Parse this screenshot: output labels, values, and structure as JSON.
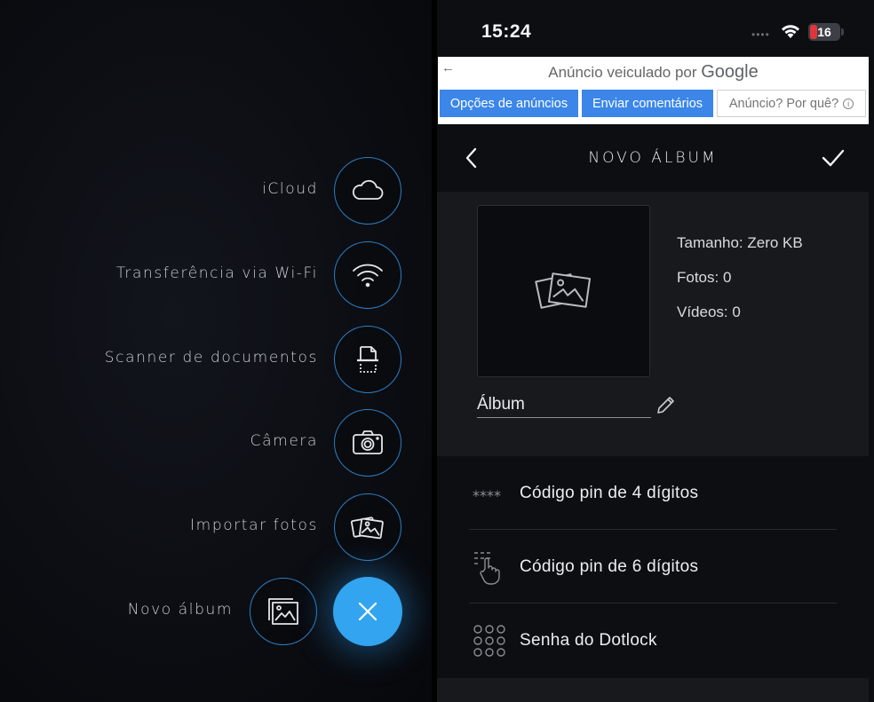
{
  "left_menu": {
    "items": [
      {
        "label": "iCloud",
        "icon": "cloud-icon"
      },
      {
        "label": "Transferência via Wi-Fi",
        "icon": "wifi-icon"
      },
      {
        "label": "Scanner de documentos",
        "icon": "document-scanner-icon"
      },
      {
        "label": "Câmera",
        "icon": "camera-icon"
      },
      {
        "label": "Importar fotos",
        "icon": "photos-icon"
      },
      {
        "label": "Novo álbum",
        "icon": "album-icon"
      }
    ],
    "close_icon": "close-icon",
    "accent_color": "#33a4f0",
    "ring_color": "#2c7fc4"
  },
  "status_bar": {
    "time": "15:24",
    "battery": "16",
    "battery_color": "#e0363b"
  },
  "ad_banner": {
    "prefix": "Anúncio veiculado por",
    "brand": "Google",
    "buttons": [
      "Opções de anúncios",
      "Enviar comentários",
      "Anúncio? Por quê?"
    ],
    "button_color": "#3b86e8"
  },
  "nav": {
    "title": "NOVO ÁLBUM",
    "back_icon": "chevron-left-icon",
    "confirm_icon": "checkmark-icon"
  },
  "album": {
    "size": "Tamanho: Zero KB",
    "photos": "Fotos: 0",
    "videos": "Vídeos: 0",
    "name_value": "Álbum"
  },
  "lock_options": [
    {
      "label": "Código pin de 4 dígitos",
      "icon": "pin-4-icon"
    },
    {
      "label": "Código pin de 6 dígitos",
      "icon": "pin-6-icon"
    },
    {
      "label": "Senha do Dotlock",
      "icon": "dotlock-icon"
    }
  ]
}
